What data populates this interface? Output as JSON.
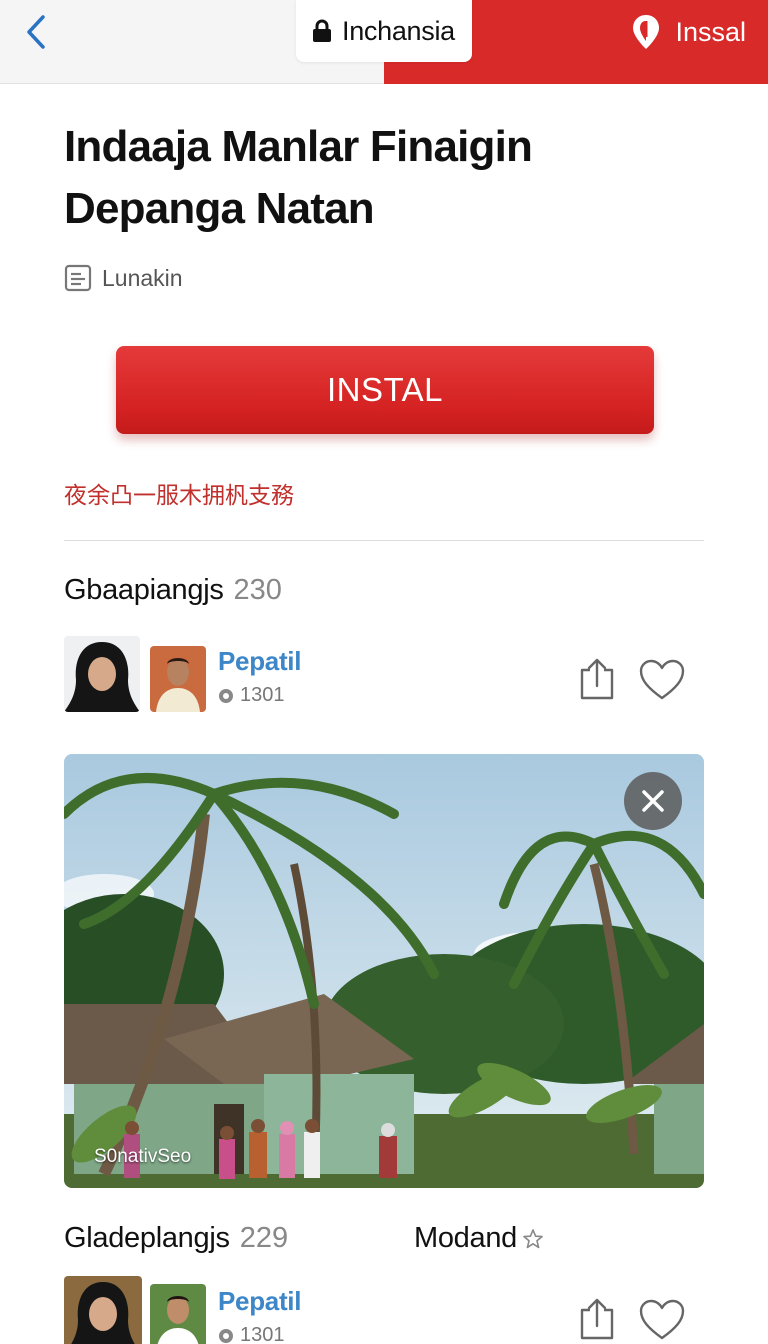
{
  "topbar": {
    "back_icon": "chevron-left-icon",
    "url_text": "Inchansia",
    "lock_icon": "lock-icon",
    "install_label": "Inssal",
    "install_icon": "pin-icon",
    "accent": "#d92a2a"
  },
  "article": {
    "title": "Indaaja Manlar Finaigin Depanga Natan",
    "source_label": "Lunakin",
    "install_label": "INSTAL",
    "notice": "夜余凸一服木拥杋支務",
    "accent_red": "#d52222",
    "link_blue": "#3d86c8"
  },
  "sections": [
    {
      "name": "Gbaapiangjs",
      "count": "230",
      "author": {
        "name": "Pepatil",
        "meta": "1301"
      },
      "photo_caption": "S0nativSeo"
    },
    {
      "name": "Gladeplangjs",
      "count": "229",
      "extra_label": "Modand",
      "author": {
        "name": "Pepatil",
        "meta": "1301"
      }
    }
  ]
}
